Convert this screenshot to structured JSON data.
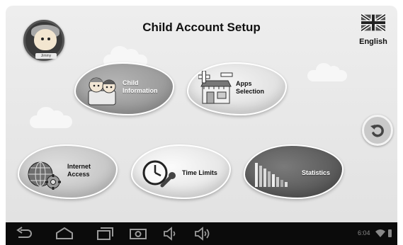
{
  "header": {
    "title": "Child Account Setup",
    "language_label": "English",
    "language_flag": "uk-flag-icon"
  },
  "avatar": {
    "nametag": "Jimmy"
  },
  "menu": {
    "child_information": "Child\nInformation",
    "apps_selection": "Apps\nSelection",
    "internet_access": "Internet\nAccess",
    "time_limits": "Time Limits",
    "statistics": "Statistics"
  },
  "status_bar": {
    "time": "6:04"
  },
  "colors": {
    "background": "#e6e6e6",
    "navbar": "#0b0b0b",
    "button_border": "#ffffff"
  }
}
